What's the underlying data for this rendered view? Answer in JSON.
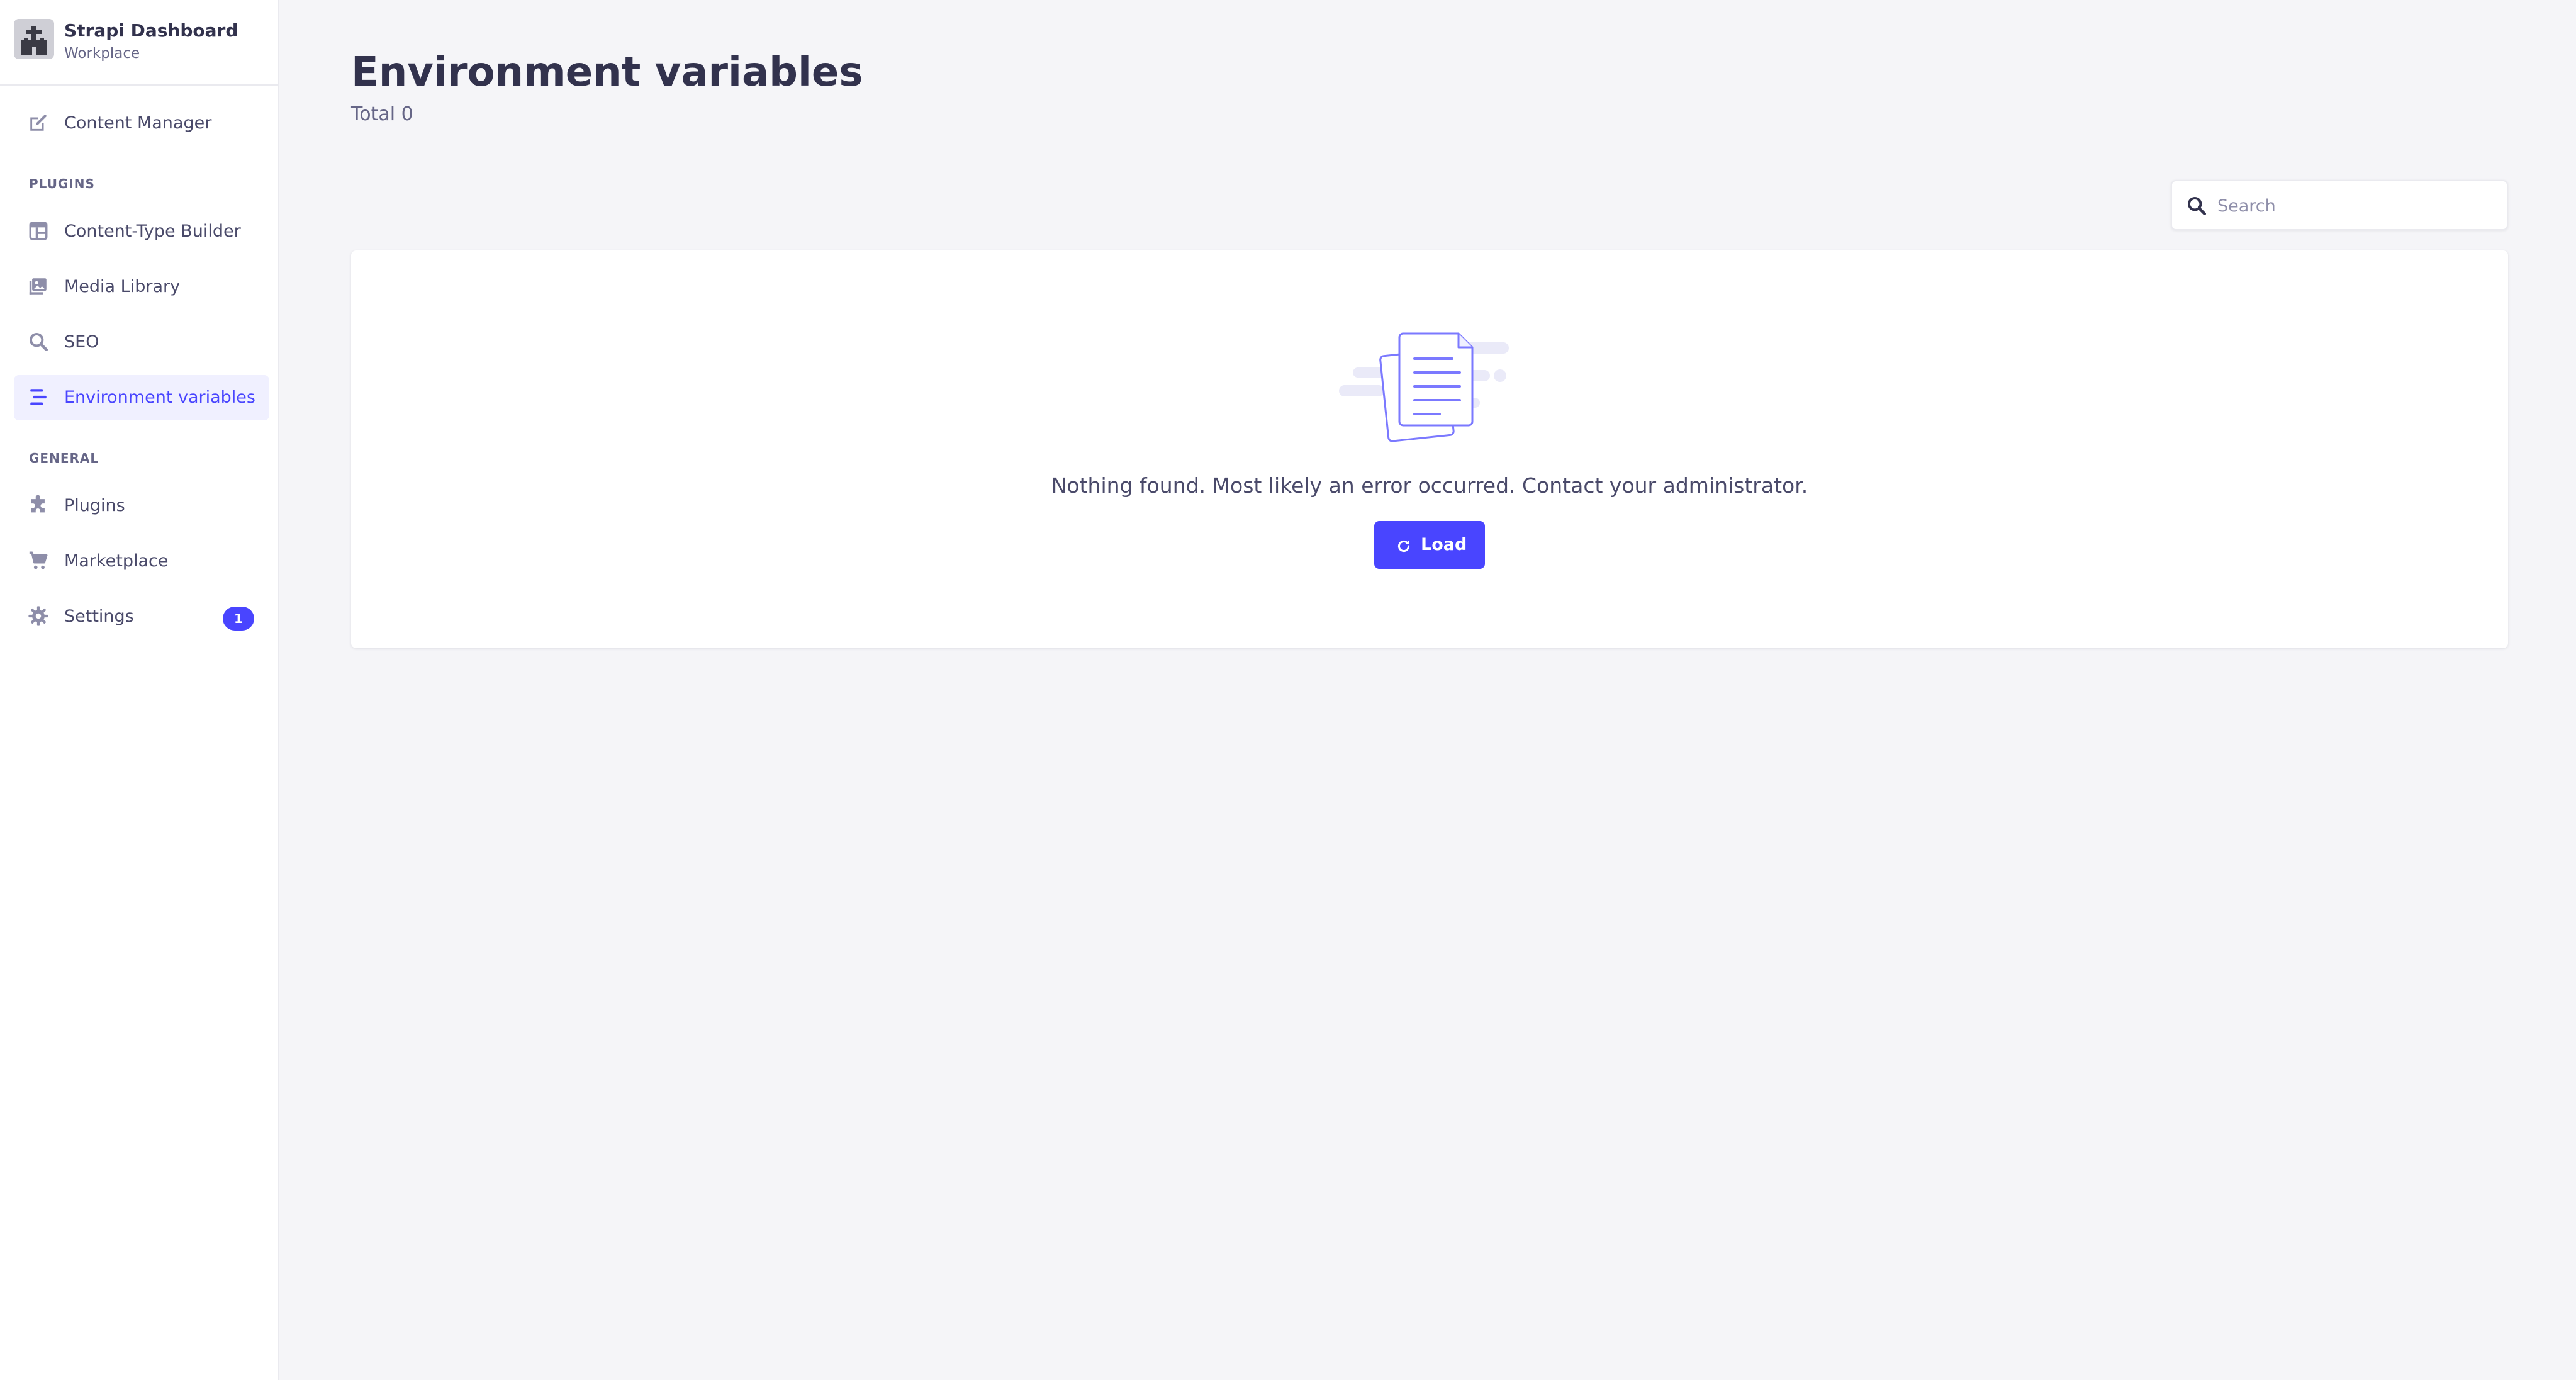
{
  "sidebar": {
    "brand": {
      "title": "Strapi Dashboard",
      "subtitle": "Workplace"
    },
    "top_items": [
      {
        "label": "Content Manager",
        "icon": "content-manager-icon"
      }
    ],
    "sections": [
      {
        "title": "PLUGINS",
        "items": [
          {
            "label": "Content-Type Builder",
            "icon": "content-type-builder-icon"
          },
          {
            "label": "Media Library",
            "icon": "media-library-icon"
          },
          {
            "label": "SEO",
            "icon": "search-icon"
          },
          {
            "label": "Environment variables",
            "icon": "environment-variables-icon",
            "active": true
          }
        ]
      },
      {
        "title": "GENERAL",
        "items": [
          {
            "label": "Plugins",
            "icon": "puzzle-icon"
          },
          {
            "label": "Marketplace",
            "icon": "cart-icon"
          },
          {
            "label": "Settings",
            "icon": "gear-icon",
            "badge": "1"
          }
        ]
      }
    ]
  },
  "header": {
    "title": "Environment variables",
    "subtitle": "Total 0"
  },
  "search": {
    "placeholder": "Search",
    "value": ""
  },
  "empty_state": {
    "message": "Nothing found. Most likely an error occurred. Contact your administrator.",
    "button_label": "Load",
    "illustration": "documents-illustration"
  },
  "colors": {
    "primary": "#4945ff",
    "active_bg": "#f0f0ff",
    "page_bg": "#f5f5f8",
    "text_dark": "#32324d",
    "text_muted": "#666687"
  }
}
